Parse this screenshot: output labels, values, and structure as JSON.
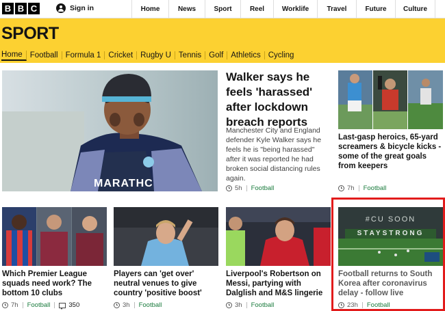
{
  "header": {
    "logo_letters": [
      "B",
      "B",
      "C"
    ],
    "signin_label": "Sign in",
    "nav": [
      "Home",
      "News",
      "Sport",
      "Reel",
      "Worklife",
      "Travel",
      "Future",
      "Culture"
    ]
  },
  "sport_title": "SPORT",
  "subnav": [
    "Home",
    "Football",
    "Formula 1",
    "Cricket",
    "Rugby U",
    "Tennis",
    "Golf",
    "Athletics",
    "Cycling"
  ],
  "colors": {
    "sport_yellow": "#fcd131",
    "section_green": "#1a7b3d",
    "highlight_red": "#e21b1b"
  },
  "stories": {
    "lead": {
      "headline": "Walker says he feels 'harassed' after lockdown breach reports",
      "summary": "Manchester City and England defender Kyle Walker says he feels he is \"being harassed\" after it was reported he had broken social distancing rules again.",
      "time": "5h",
      "section": "Football",
      "image_text": "MARATHC"
    },
    "top_right": {
      "headline": "Last-gasp heroics, 65-yard screamers & bicycle kicks - some of the great goals from keepers",
      "time": "7h",
      "section": "Football"
    },
    "s1": {
      "headline": "Which Premier League squads need work? The bottom 10 clubs",
      "time": "7h",
      "section": "Football",
      "comments": "350"
    },
    "s2": {
      "headline": "Players can 'get over' neutral venues to give country 'positive boost'",
      "time": "3h",
      "section": "Football"
    },
    "s3": {
      "headline": "Liverpool's Robertson on Messi, partying with Dalglish and M&S lingerie",
      "time": "3h",
      "section": "Football"
    },
    "s4": {
      "headline": "Football returns to South Korea after coronavirus delay - follow live",
      "time": "23h",
      "section": "Football",
      "image_text_top": "#CU SOON",
      "image_text_banner": "STAYSTRONG"
    }
  }
}
